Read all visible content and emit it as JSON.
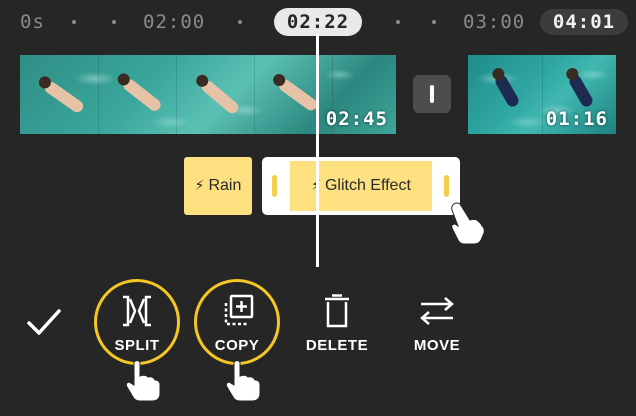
{
  "ruler": {
    "labels": [
      "0s",
      "02:00",
      "03:00"
    ],
    "playhead_time": "02:22",
    "total_time": "04:01"
  },
  "clips": [
    {
      "duration": "02:45"
    },
    {
      "duration": "01:16"
    }
  ],
  "effects": [
    {
      "label": "Rain"
    },
    {
      "label": "Glitch Effect"
    }
  ],
  "toolbar": {
    "split_label": "SPLIT",
    "copy_label": "COPY",
    "delete_label": "DELETE",
    "move_label": "MOVE"
  },
  "colors": {
    "background": "#262626",
    "accent_ring": "#f4c724",
    "effect_chip": "#fde07f",
    "water": "#3aa79c"
  },
  "icons": {
    "confirm": "checkmark-icon",
    "split": "split-icon",
    "copy": "copy-icon",
    "delete": "trash-icon",
    "move": "swap-arrows-icon",
    "effect": "lightning-bolt-icon",
    "gesture": "pointing-hand-icon"
  }
}
